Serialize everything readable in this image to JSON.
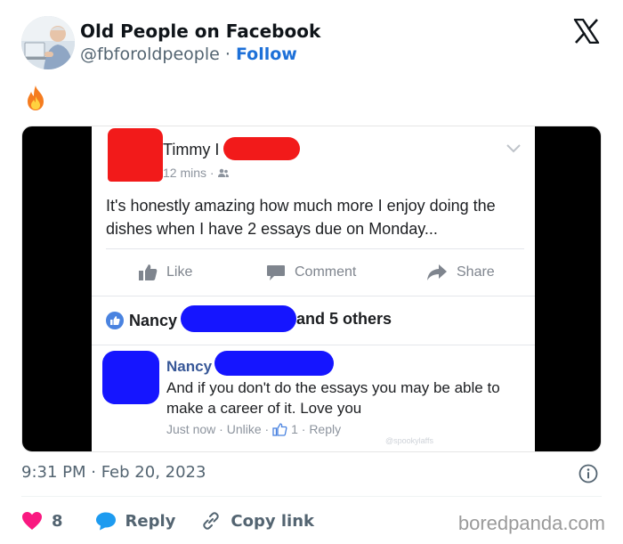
{
  "tweet": {
    "author_name": "Old People on Facebook",
    "handle": "@fbforoldpeople",
    "separator": "·",
    "follow_label": "Follow",
    "emoji": "🔥",
    "timestamp": "9:31 PM · Feb 20, 2023",
    "likes_count": "8",
    "reply_label": "Reply",
    "copy_link_label": "Copy link",
    "like_color": "#f91880",
    "accent_color": "#1d9bf0"
  },
  "fb_post": {
    "author_name": "Timmy I",
    "time": "12 mins · ",
    "text": "It's honestly amazing how much more I enjoy doing the dishes when I have 2 essays due on Monday...",
    "actions": {
      "like": "Like",
      "comment": "Comment",
      "share": "Share"
    },
    "likes_name": "Nancy",
    "likes_others": "and 5 others",
    "comment": {
      "author": "Nancy",
      "text": "And if you don't do the essays you may be able to make a career of it.  Love you",
      "meta_time": "Just now",
      "meta_dot": " · ",
      "meta_unlike": "Unlike",
      "meta_count": "1",
      "meta_reply": "Reply"
    },
    "ig_watermark": "@spookylaffs",
    "redaction_color_red": "#f21a1a",
    "redaction_color_blue": "#1515ff"
  },
  "watermark": "boredpanda.com",
  "icons": [
    "x-logo-icon",
    "fire-emoji",
    "info-icon",
    "heart-icon",
    "reply-bubble-icon",
    "link-icon"
  ]
}
